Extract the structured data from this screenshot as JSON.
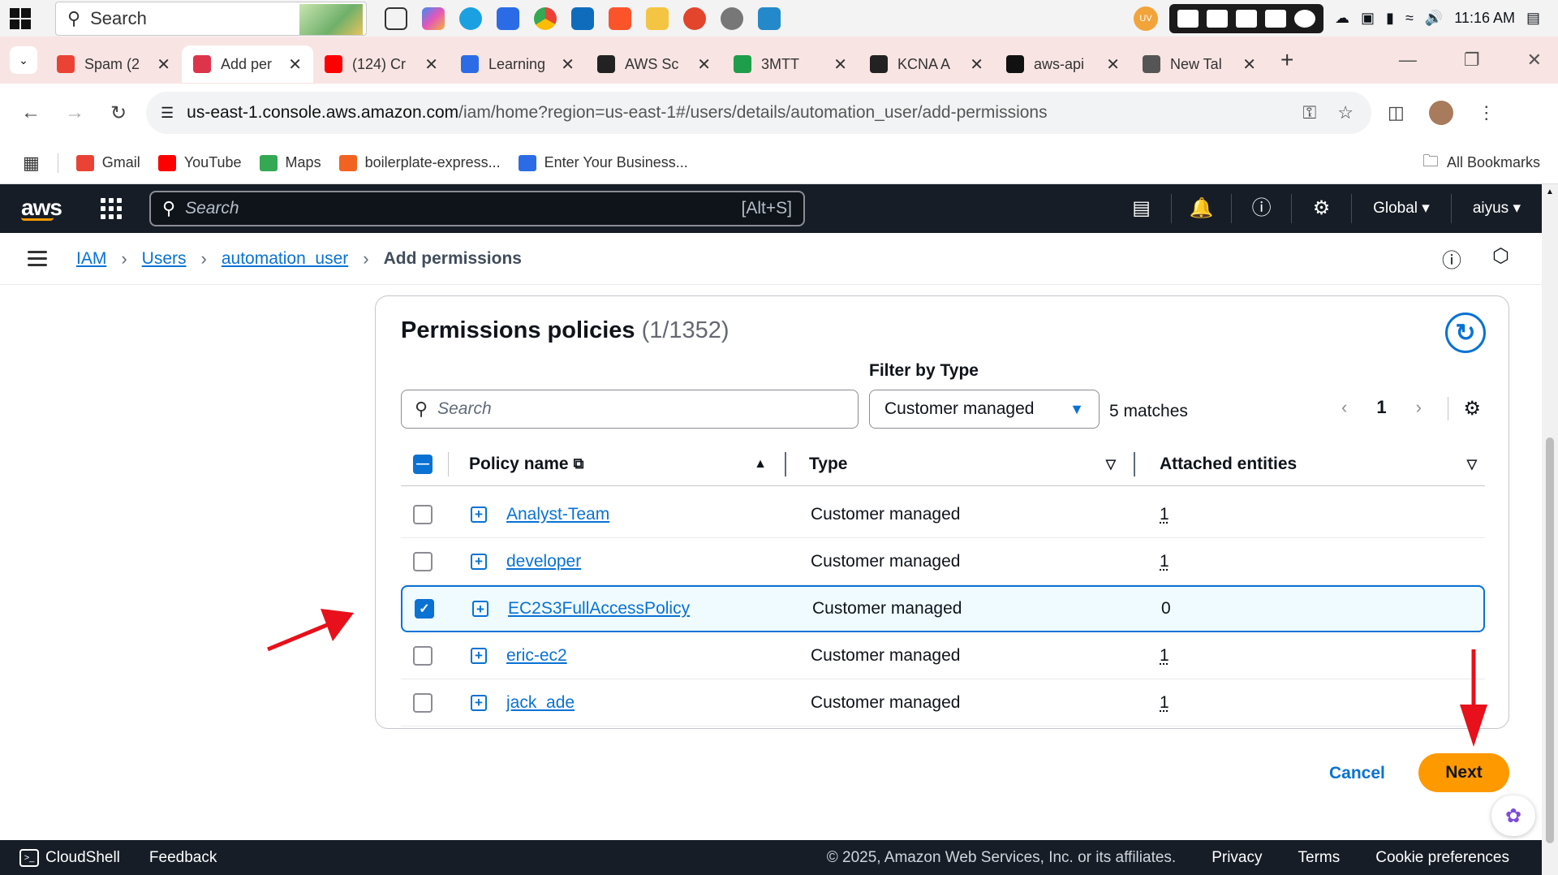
{
  "taskbar": {
    "search_placeholder": "Search",
    "time": "11:16 AM",
    "tray_badge": "UV"
  },
  "browser": {
    "tabs": [
      {
        "label": "Spam (2",
        "color": "#ea4335"
      },
      {
        "label": "Add per",
        "color": "#dd344c"
      },
      {
        "label": "(124) Cr",
        "color": "#ff0000"
      },
      {
        "label": "Learning",
        "color": "#2b6ce6"
      },
      {
        "label": "AWS Sc",
        "color": "#222222"
      },
      {
        "label": "3MTT",
        "color": "#1e9e4a"
      },
      {
        "label": "KCNA A",
        "color": "#222222"
      },
      {
        "label": "aws-api",
        "color": "#111111"
      },
      {
        "label": "New Tal",
        "color": "#555555"
      }
    ],
    "address": {
      "domain": "us-east-1.console.aws.amazon.com",
      "path": "/iam/home?region=us-east-1#/users/details/automation_user/add-permissions"
    },
    "bookmarks": [
      {
        "label": "Gmail",
        "color": "#ea4335"
      },
      {
        "label": "YouTube",
        "color": "#ff0000"
      },
      {
        "label": "Maps",
        "color": "#34a853"
      },
      {
        "label": "boilerplate-express...",
        "color": "#f26322"
      },
      {
        "label": "Enter Your Business...",
        "color": "#2b6ce6"
      }
    ],
    "all_bookmarks": "All Bookmarks"
  },
  "aws_nav": {
    "logo": "aws",
    "search_placeholder": "Search",
    "search_shortcut": "[Alt+S]",
    "region": "Global",
    "user": "aiyus"
  },
  "breadcrumb": {
    "items": [
      "IAM",
      "Users",
      "automation_user"
    ],
    "current": "Add permissions"
  },
  "policies": {
    "title": "Permissions policies",
    "count": "(1/1352)",
    "filter_label": "Filter by Type",
    "search_placeholder": "Search",
    "filter_value": "Customer managed",
    "matches": "5 matches",
    "page": "1",
    "columns": {
      "name": "Policy name",
      "type": "Type",
      "attached": "Attached entities"
    },
    "rows": [
      {
        "name": "Analyst-Team",
        "type": "Customer managed",
        "attached": "1",
        "selected": false
      },
      {
        "name": "developer",
        "type": "Customer managed",
        "attached": "1",
        "selected": false
      },
      {
        "name": "EC2S3FullAccessPolicy",
        "type": "Customer managed",
        "attached": "0",
        "selected": true
      },
      {
        "name": "eric-ec2",
        "type": "Customer managed",
        "attached": "1",
        "selected": false
      },
      {
        "name": "jack_ade",
        "type": "Customer managed",
        "attached": "1",
        "selected": false
      }
    ]
  },
  "actions": {
    "cancel": "Cancel",
    "next": "Next"
  },
  "footer": {
    "cloudshell": "CloudShell",
    "feedback": "Feedback",
    "copyright": "© 2025, Amazon Web Services, Inc. or its affiliates.",
    "links": [
      "Privacy",
      "Terms",
      "Cookie preferences"
    ]
  },
  "colors": {
    "aws_dark": "#161d26",
    "link_blue": "#0972d3",
    "primary_orange": "#ff9900",
    "annotation_red": "#e8101a"
  }
}
